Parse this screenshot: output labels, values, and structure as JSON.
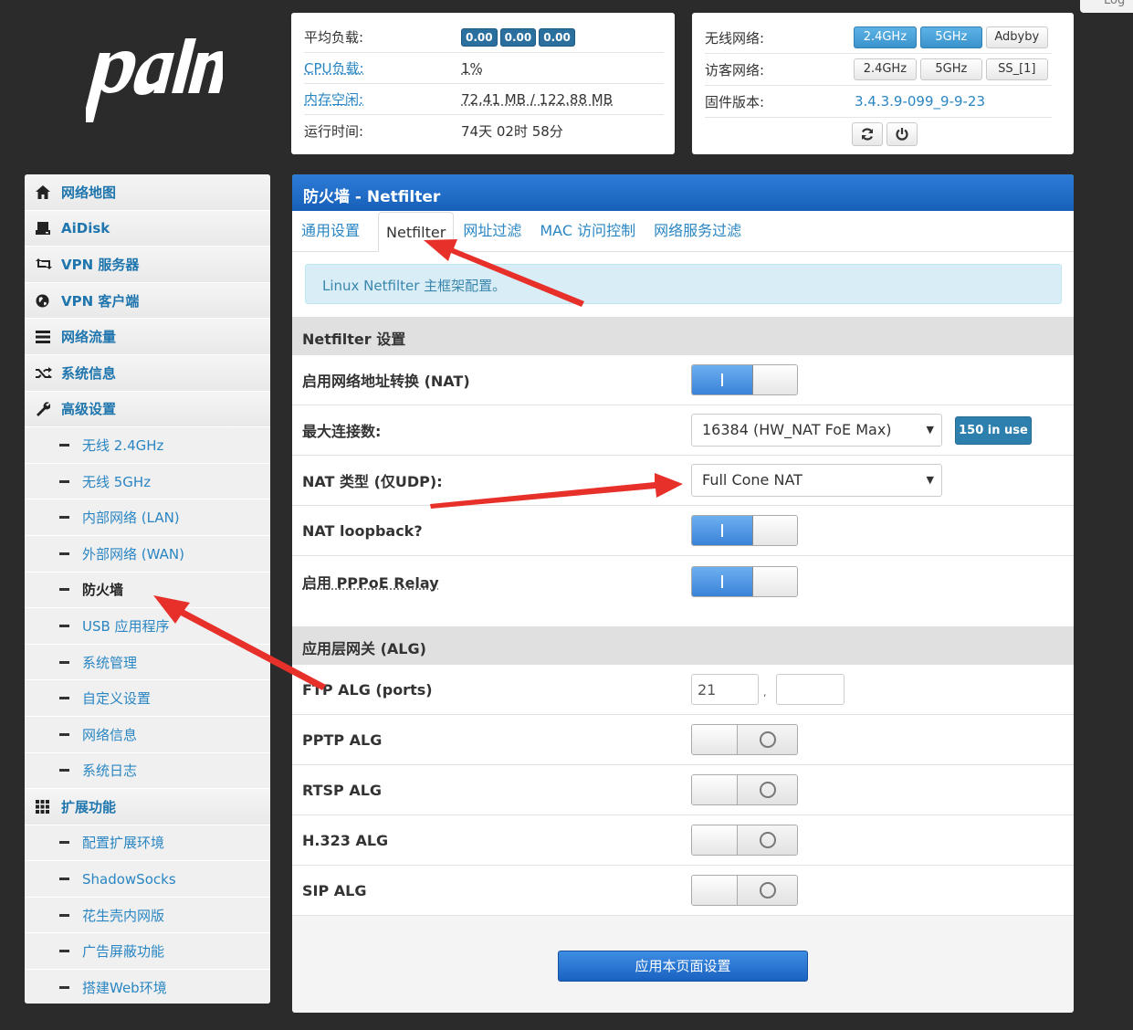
{
  "top_right_tab": "Log",
  "status": {
    "load_label": "平均负载:",
    "load_values": [
      "0.00",
      "0.00",
      "0.00"
    ],
    "cpu_label": "CPU负载:",
    "cpu_value": "1%",
    "mem_label": "内存空闲:",
    "mem_value": "72.41 MB / 122.88 MB",
    "uptime_label": "运行时间:",
    "uptime_value": "74天 02时 58分"
  },
  "wireless": {
    "wifi_label": "无线网络:",
    "wifi_buttons": [
      "2.4GHz",
      "5GHz",
      "Adbyby"
    ],
    "guest_label": "访客网络:",
    "guest_buttons": [
      "2.4GHz",
      "5GHz",
      "SS_[1]"
    ],
    "fw_label": "固件版本:",
    "fw_value": "3.4.3.9-099_9-9-23"
  },
  "sidebar": {
    "items": [
      {
        "label": "网络地图",
        "icon": "home-icon"
      },
      {
        "label": "AiDisk",
        "icon": "disk-icon"
      },
      {
        "label": "VPN 服务器",
        "icon": "retweet-icon"
      },
      {
        "label": "VPN 客户端",
        "icon": "globe-icon"
      },
      {
        "label": "网络流量",
        "icon": "list-icon"
      },
      {
        "label": "系统信息",
        "icon": "shuffle-icon"
      },
      {
        "label": "高级设置",
        "icon": "wrench-icon"
      }
    ],
    "advanced_sub": [
      "无线 2.4GHz",
      "无线 5GHz",
      "内部网络 (LAN)",
      "外部网络 (WAN)",
      "防火墙",
      "USB 应用程序",
      "系统管理",
      "自定义设置",
      "网络信息",
      "系统日志"
    ],
    "ext_label": "扩展功能",
    "ext_sub": [
      "配置扩展环境",
      "ShadowSocks",
      "花生壳内网版",
      "广告屏蔽功能",
      "搭建Web环境"
    ]
  },
  "main": {
    "title": "防火墙 - Netfilter",
    "tabs": [
      "通用设置",
      "Netfilter",
      "网址过滤",
      "MAC 访问控制",
      "网络服务过滤"
    ],
    "info": "Linux Netfilter 主框架配置。",
    "section1": "Netfilter 设置",
    "nat_label": "启用网络地址转换 (NAT)",
    "maxconn_label": "最大连接数:",
    "maxconn_value": "16384 (HW_NAT FoE Max)",
    "in_use": "150 in use",
    "nattype_label": "NAT 类型 (仅UDP):",
    "nattype_value": "Full Cone NAT",
    "loopback_label": "NAT loopback?",
    "pppoe_label": "启用 PPPoE Relay",
    "section2": "应用层网关 (ALG)",
    "ftp_label": "FTP ALG (ports)",
    "ftp_port1": "21",
    "ftp_port2": "",
    "ftp_sep": ",",
    "pptp_label": "PPTP ALG",
    "rtsp_label": "RTSP ALG",
    "h323_label": "H.323 ALG",
    "sip_label": "SIP ALG",
    "apply_label": "应用本页面设置"
  },
  "colors": {
    "link": "#2a86c3",
    "header_blue": "#1760b8",
    "annotation_red": "#e8302b"
  }
}
